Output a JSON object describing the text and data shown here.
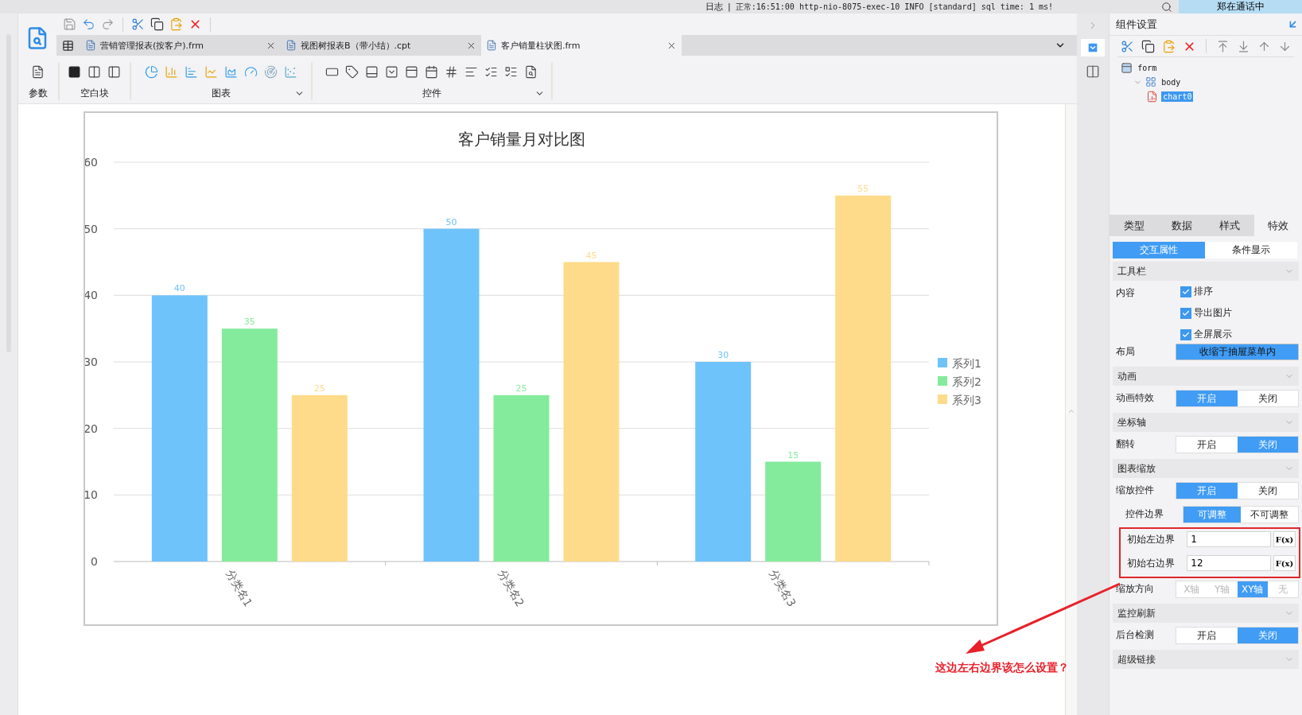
{
  "top_bar": {
    "log_label": "日志",
    "separator": "|",
    "log_text": "正常:16:51:00 http-nio-8075-exec-10 INFO [standard] sql time: 1 ms!",
    "call_status": "郑在通话中"
  },
  "file_tabs": [
    {
      "label": "营销管理报表(按客户).frm",
      "selected": false
    },
    {
      "label": "视图树报表B（带小结）.cpt",
      "selected": false
    },
    {
      "label": "客户销量柱状图.frm",
      "selected": true
    }
  ],
  "tool_groups": [
    {
      "kind": "param",
      "label": "参数"
    },
    {
      "kind": "blank",
      "label": "空白块"
    },
    {
      "kind": "chart",
      "label": "图表"
    },
    {
      "kind": "widget",
      "label": "控件"
    }
  ],
  "chart": {
    "chart_data": {
      "type": "bar",
      "title": "客户销量月对比图",
      "categories": [
        "分类名1",
        "分类名2",
        "分类名3"
      ],
      "series": [
        {
          "name": "系列1",
          "color": "#6ec3fb",
          "values": [
            40,
            50,
            30
          ]
        },
        {
          "name": "系列2",
          "color": "#84eb9c",
          "values": [
            35,
            25,
            15
          ]
        },
        {
          "name": "系列3",
          "color": "#fedb8a",
          "values": [
            25,
            45,
            55
          ]
        }
      ],
      "ylim": [
        0,
        60
      ],
      "yticks": [
        0,
        10,
        20,
        30,
        40,
        50,
        60
      ],
      "data_labels": true,
      "grid": true,
      "legend": "right"
    }
  },
  "annotation": {
    "text": "这边左右边界该怎么设置？"
  },
  "panel": {
    "title": "组件设置",
    "tree": [
      {
        "label": "form",
        "selected": false,
        "children": [
          {
            "label": "body",
            "selected": false,
            "expanded": true,
            "children": [
              {
                "label": "chart0",
                "selected": true
              }
            ]
          }
        ]
      }
    ],
    "tabs": [
      {
        "label": "类型",
        "selected": false
      },
      {
        "label": "数据",
        "selected": false
      },
      {
        "label": "样式",
        "selected": false
      },
      {
        "label": "特效",
        "selected": true
      }
    ],
    "subtabs": [
      {
        "label": "交互属性",
        "selected": true
      },
      {
        "label": "条件显示",
        "selected": false
      }
    ],
    "sections": [
      {
        "title": "工具栏",
        "rows": [
          {
            "kind": "checks",
            "label": "内容",
            "items": [
              {
                "label": "排序",
                "checked": true
              },
              {
                "label": "导出图片",
                "checked": true
              },
              {
                "label": "全屏展示",
                "checked": true
              }
            ]
          },
          {
            "kind": "select",
            "label": "布局",
            "value": "收缩于抽屉菜单内"
          }
        ]
      },
      {
        "title": "动画",
        "rows": [
          {
            "kind": "toggle",
            "label": "动画特效",
            "options": [
              {
                "label": "开启",
                "selected": true
              },
              {
                "label": "关闭",
                "selected": false
              }
            ]
          }
        ]
      },
      {
        "title": "坐标轴",
        "rows": [
          {
            "kind": "toggle",
            "label": "翻转",
            "options": [
              {
                "label": "开启",
                "selected": false
              },
              {
                "label": "关闭",
                "selected": true
              }
            ]
          }
        ]
      },
      {
        "title": "图表缩放",
        "rows": [
          {
            "kind": "toggle",
            "label": "缩放控件",
            "options": [
              {
                "label": "开启",
                "selected": true
              },
              {
                "label": "关闭",
                "selected": false
              }
            ],
            "children": [
              {
                "kind": "toggle",
                "label": "控件边界",
                "options": [
                  {
                    "label": "可调整",
                    "selected": true
                  },
                  {
                    "label": "不可调整",
                    "selected": false
                  }
                ]
              },
              {
                "kind": "input",
                "label": "初始左边界",
                "value": "1",
                "formula": "F(x)",
                "highlighted": true
              },
              {
                "kind": "input",
                "label": "初始右边界",
                "value": "12",
                "formula": "F(x)",
                "highlighted": true
              }
            ]
          },
          {
            "kind": "toggle",
            "label": "缩放方向",
            "options": [
              {
                "label": "X轴",
                "selected": false,
                "disabled": true
              },
              {
                "label": "Y轴",
                "selected": false,
                "disabled": true
              },
              {
                "label": "XY轴",
                "selected": true,
                "disabled": false
              },
              {
                "label": "无",
                "selected": false,
                "disabled": true
              }
            ]
          }
        ]
      },
      {
        "title": "监控刷新",
        "rows": [
          {
            "kind": "toggle",
            "label": "后台检测",
            "options": [
              {
                "label": "开启",
                "selected": false
              },
              {
                "label": "关闭",
                "selected": true
              }
            ]
          }
        ]
      },
      {
        "title": "超级链接"
      }
    ]
  }
}
